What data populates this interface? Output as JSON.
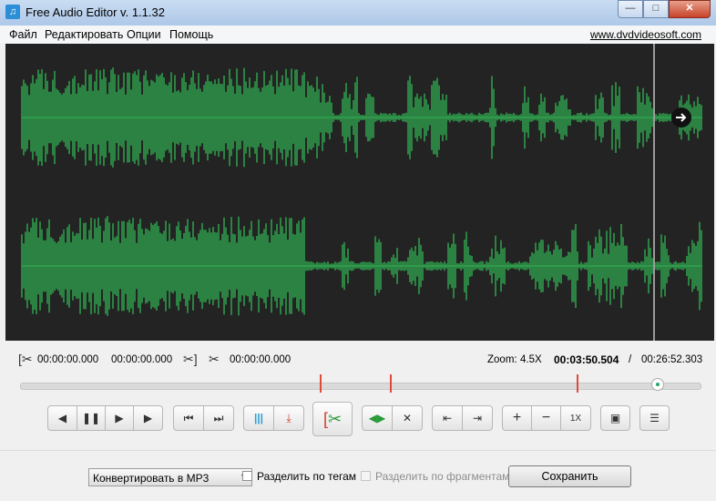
{
  "window": {
    "title": "Free Audio Editor v. 1.1.32",
    "icon": "music-note-icon"
  },
  "menu": {
    "items": [
      "Файл",
      "Редактировать",
      "Опции",
      "Помощь"
    ],
    "site_link": "www.dvdvideosoft.com"
  },
  "waveform": {
    "color": "#2f9a4a",
    "background": "#232323"
  },
  "times": {
    "selection_start": "00:00:00.000",
    "selection_end": "00:00:00.000",
    "cut_time": "00:00:00.000",
    "zoom_label": "Zoom:",
    "zoom_value": "4.5X",
    "current": "00:03:50.504",
    "separator": "/",
    "total": "00:26:52.303"
  },
  "position": {
    "slider_value_fraction": 0.935
  },
  "toolbar": {
    "zoom_reset_label": "1X"
  },
  "bottom": {
    "convert_select": "Конвертировать в MP3",
    "split_by_tags": "Разделить по тегам",
    "split_by_fragments": "Разделить по фрагментам",
    "save_label": "Сохранить"
  }
}
